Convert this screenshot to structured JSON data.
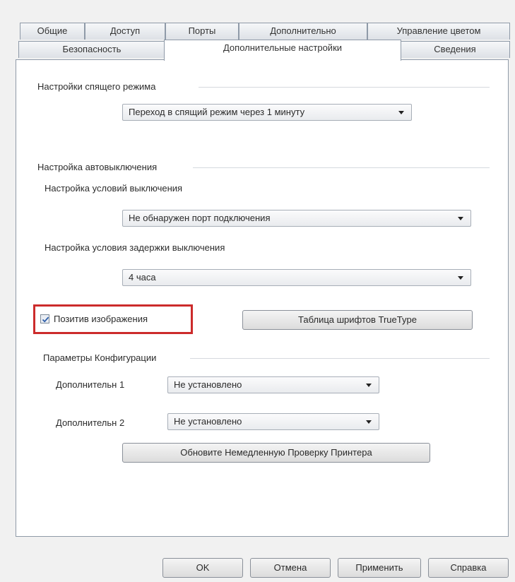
{
  "tabs_row1": [
    "Общие",
    "Доступ",
    "Порты",
    "Дополнительно",
    "Управление цветом"
  ],
  "tabs_row2": [
    "Безопасность",
    "Дополнительные настройки",
    "Сведения"
  ],
  "active_tab": "Дополнительные настройки",
  "sleep": {
    "group_label": "Настройки спящего режима",
    "value": "Переход в спящий режим через 1 минуту"
  },
  "autooff": {
    "group_label": "Настройка автовыключения",
    "condition_label": "Настройка условий выключения",
    "condition_value": "Не обнаружен порт подключения",
    "delay_label": "Настройка условия задержки выключения",
    "delay_value": "4 часа"
  },
  "positive": {
    "label": "Позитив изображения",
    "checked": true,
    "highlight_color": "#cc2b2b"
  },
  "truetype_button": "Таблица шрифтов TrueType",
  "config": {
    "group_label": "Параметры Конфигурации",
    "opt1_label": "Дополнительн 1",
    "opt1_value": "Не установлено",
    "opt2_label": "Дополнительн 2",
    "opt2_value": "Не установлено",
    "update_button": "Обновите Немедленную Проверку Принтера"
  },
  "footer": {
    "ok": "OK",
    "cancel": "Отмена",
    "apply": "Применить",
    "help": "Справка"
  }
}
